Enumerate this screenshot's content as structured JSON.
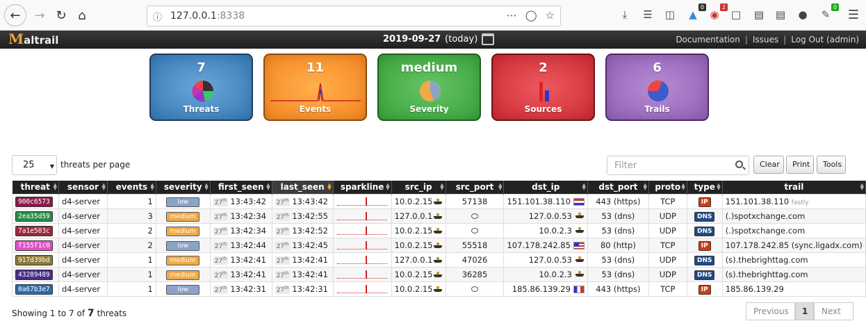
{
  "browser": {
    "url_host": "127.0.0.1",
    "url_port": ":8338",
    "badges": [
      "0",
      "2",
      "0"
    ]
  },
  "header": {
    "logo_text": "altrail",
    "date": "2019-09-27",
    "date_suffix": "(today)",
    "links": [
      "Documentation",
      "Issues",
      "Log Out (admin)"
    ]
  },
  "status": [
    {
      "value": "7",
      "label": "Threats"
    },
    {
      "value": "11",
      "label": "Events"
    },
    {
      "value": "medium",
      "label": "Severity"
    },
    {
      "value": "2",
      "label": "Sources"
    },
    {
      "value": "6",
      "label": "Trails"
    }
  ],
  "controls": {
    "per_page": "25",
    "per_page_label": "threats per page",
    "filter_placeholder": "Filter",
    "buttons": [
      "Clear",
      "Print",
      "Tools"
    ]
  },
  "table": {
    "columns": [
      "threat",
      "sensor",
      "events",
      "severity",
      "first_seen",
      "last_seen",
      "sparkline",
      "src_ip",
      "src_port",
      "dst_ip",
      "dst_port",
      "proto",
      "type",
      "trail"
    ],
    "rows": [
      {
        "threat": "900c6573",
        "color": "#8b1a4a",
        "sensor": "d4-server",
        "events": "1",
        "severity": "low",
        "day": "27",
        "first_seen": "13:43:42",
        "last_seen": "13:43:42",
        "src_ip": "10.0.2.15",
        "src_port": "57138",
        "dst_ip": "151.101.38.110",
        "flag": "nl",
        "dst_port": "443 (https)",
        "proto": "TCP",
        "type": "IP",
        "trail": "151.101.38.110",
        "trail_sub": "fastly"
      },
      {
        "threat": "2ea35d59",
        "color": "#2a8a4a",
        "sensor": "d4-server",
        "events": "3",
        "severity": "medium",
        "day": "27",
        "first_seen": "13:42:34",
        "last_seen": "13:42:55",
        "src_ip": "127.0.0.1",
        "src_port": "",
        "dst_ip": "127.0.0.53",
        "flag": "",
        "dst_port": "53 (dns)",
        "proto": "UDP",
        "type": "DNS",
        "trail": "(.)spotxchange.com",
        "trail_sub": ""
      },
      {
        "threat": "7a1e503c",
        "color": "#9a2a3a",
        "sensor": "d4-server",
        "events": "2",
        "severity": "medium",
        "day": "27",
        "first_seen": "13:42:34",
        "last_seen": "13:42:52",
        "src_ip": "10.0.2.15",
        "src_port": "",
        "dst_ip": "10.0.2.3",
        "flag": "",
        "dst_port": "53 (dns)",
        "proto": "UDP",
        "type": "DNS",
        "trail": "(.)spotxchange.com",
        "trail_sub": ""
      },
      {
        "threat": "f155f1c0",
        "color": "#e050c8",
        "sensor": "d4-server",
        "events": "2",
        "severity": "low",
        "day": "27",
        "first_seen": "13:42:44",
        "last_seen": "13:42:45",
        "src_ip": "10.0.2.15",
        "src_port": "55518",
        "dst_ip": "107.178.242.85",
        "flag": "us",
        "dst_port": "80 (http)",
        "proto": "TCP",
        "type": "IP",
        "trail": "107.178.242.85 (sync.ligadx.com)",
        "trail_sub": ""
      },
      {
        "threat": "917d39bd",
        "color": "#8a7a3a",
        "sensor": "d4-server",
        "events": "1",
        "severity": "medium",
        "day": "27",
        "first_seen": "13:42:41",
        "last_seen": "13:42:41",
        "src_ip": "127.0.0.1",
        "src_port": "47026",
        "dst_ip": "127.0.0.53",
        "flag": "",
        "dst_port": "53 (dns)",
        "proto": "UDP",
        "type": "DNS",
        "trail": "(s).thebrighttag.com",
        "trail_sub": ""
      },
      {
        "threat": "43289489",
        "color": "#4a2a8a",
        "sensor": "d4-server",
        "events": "1",
        "severity": "medium",
        "day": "27",
        "first_seen": "13:42:41",
        "last_seen": "13:42:41",
        "src_ip": "10.0.2.15",
        "src_port": "36285",
        "dst_ip": "10.0.2.3",
        "flag": "",
        "dst_port": "53 (dns)",
        "proto": "UDP",
        "type": "DNS",
        "trail": "(s).thebrighttag.com",
        "trail_sub": ""
      },
      {
        "threat": "0a67b3e7",
        "color": "#2a6aa8",
        "sensor": "d4-server",
        "events": "1",
        "severity": "low",
        "day": "27",
        "first_seen": "13:42:31",
        "last_seen": "13:42:31",
        "src_ip": "10.0.2.15",
        "src_port": "",
        "dst_ip": "185.86.139.29",
        "flag": "fr",
        "dst_port": "443 (https)",
        "proto": "TCP",
        "type": "IP",
        "trail": "185.86.139.29",
        "trail_sub": ""
      }
    ]
  },
  "footer": {
    "showing_prefix": "Showing 1 to 7 of",
    "total": "7",
    "showing_suffix": "threats",
    "previous": "Previous",
    "page": "1",
    "next": "Next"
  }
}
